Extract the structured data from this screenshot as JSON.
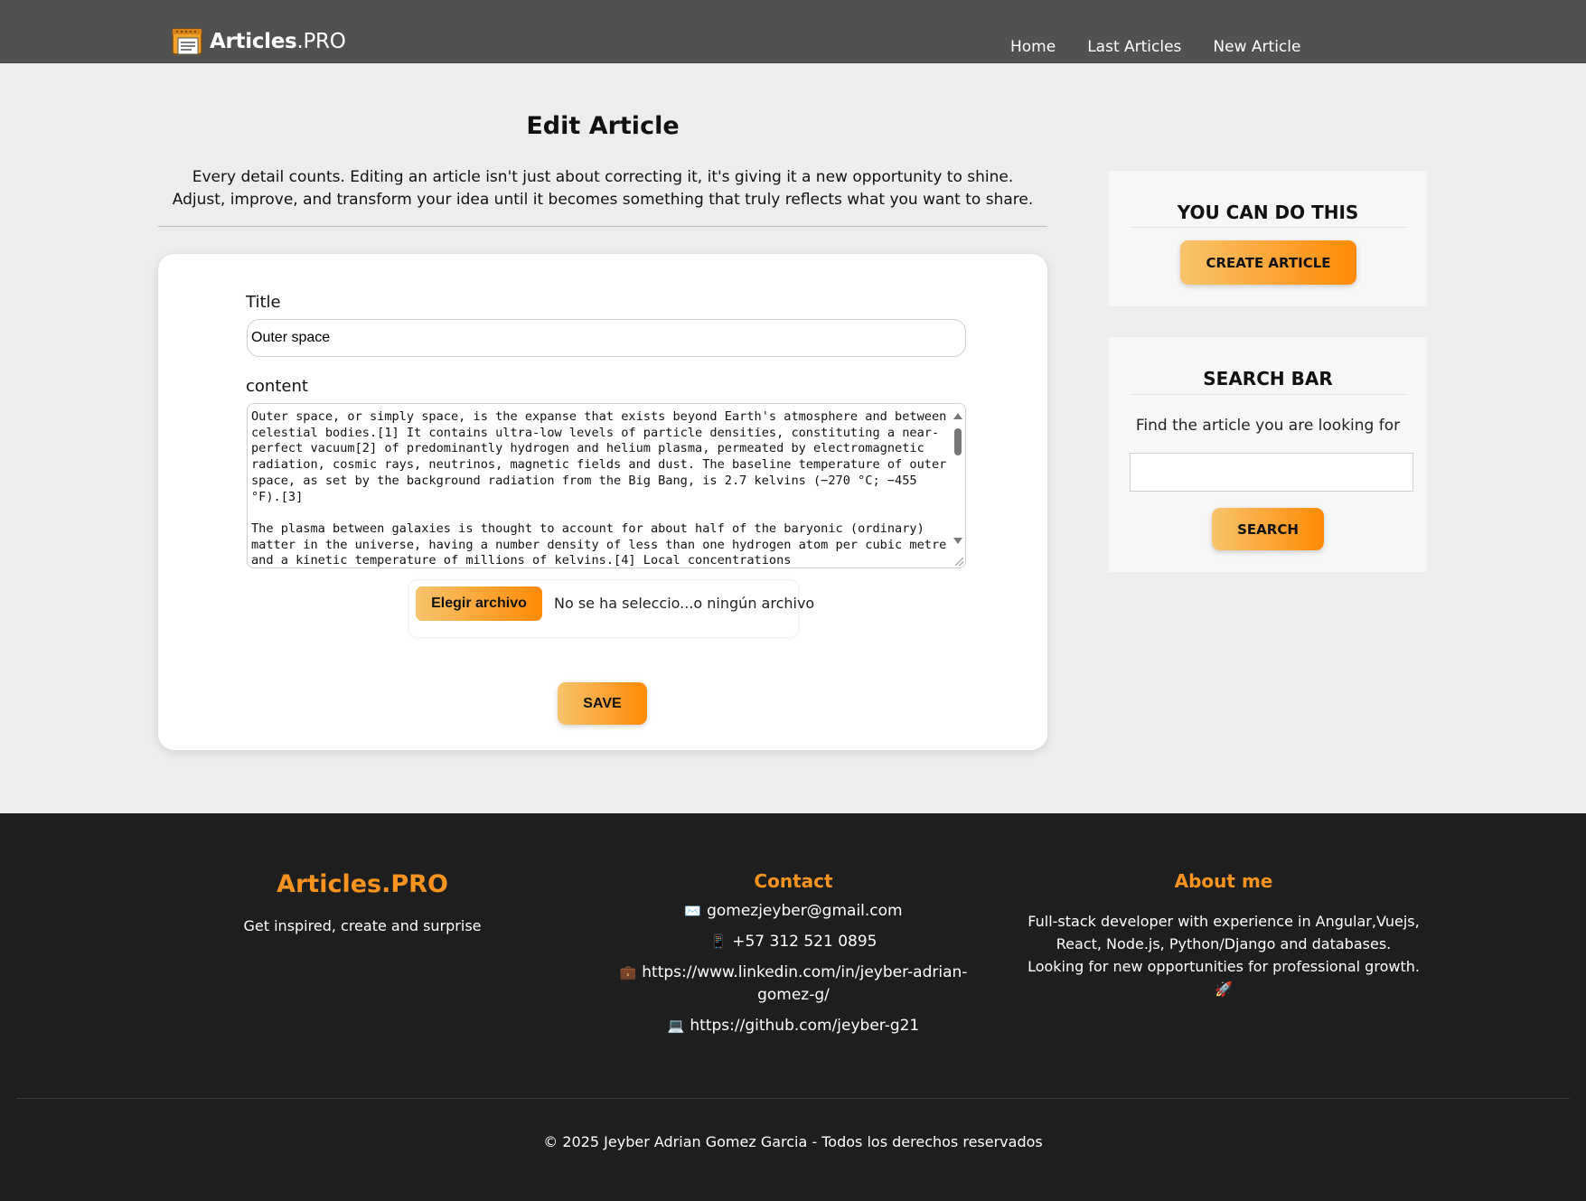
{
  "header": {
    "brand_bold": "Articles",
    "brand_light": ".PRO",
    "nav": [
      "Home",
      "Last Articles",
      "New Article"
    ]
  },
  "main": {
    "title": "Edit Article",
    "intro": "Every detail counts. Editing an article isn't just about correcting it, it's giving it a new opportunity to shine. Adjust, improve, and transform your idea until it becomes something that truly reflects what you want to share.",
    "form": {
      "title_label": "Title",
      "title_value": "Outer space",
      "content_label": "content",
      "content_value": "Outer space, or simply space, is the expanse that exists beyond Earth's atmosphere and between celestial bodies.[1] It contains ultra-low levels of particle densities, constituting a near-perfect vacuum[2] of predominantly hydrogen and helium plasma, permeated by electromagnetic radiation, cosmic rays, neutrinos, magnetic fields and dust. The baseline temperature of outer space, as set by the background radiation from the Big Bang, is 2.7 kelvins (−270 °C; −455 °F).[3]\n\nThe plasma between galaxies is thought to account for about half of the baryonic (ordinary) matter in the universe, having a number density of less than one hydrogen atom per cubic metre and a kinetic temperature of millions of kelvins.[4] Local concentrations",
      "file_button": "Elegir archivo",
      "file_status": "No se ha seleccio...o ningún archivo",
      "save_button": "SAVE"
    }
  },
  "sidebar": {
    "panel_one": {
      "heading": "YOU CAN DO THIS",
      "button": "CREATE ARTICLE"
    },
    "panel_two": {
      "heading": "SEARCH BAR",
      "prompt": "Find the article you are looking for",
      "search_value": "",
      "button": "SEARCH"
    }
  },
  "footer": {
    "brand": "Articles.PRO",
    "tagline": "Get inspired, create and surprise",
    "contact_heading": "Contact",
    "contact": [
      {
        "icon": "✉️",
        "icon_name": "envelope-icon",
        "text": "gomezjeyber@gmail.com"
      },
      {
        "icon": "📱",
        "icon_name": "phone-icon",
        "text": "+57 312 521 0895"
      },
      {
        "icon": "💼",
        "icon_name": "briefcase-icon",
        "text": "https://www.linkedin.com/in/jeyber-adrian-gomez-g/"
      },
      {
        "icon": "💻",
        "icon_name": "laptop-icon",
        "text": "https://github.com/jeyber-g21"
      }
    ],
    "about_heading": "About me",
    "about_text": "Full-stack developer with experience in Angular,Vuejs, React, Node.js, Python/Django and databases. Looking for new opportunities for professional growth. 🚀",
    "copyright": "© 2025 Jeyber Adrian Gomez Garcia - Todos los derechos reservados"
  },
  "colors": {
    "header_bg": "#515151",
    "page_bg": "#eeedeb",
    "footer_bg": "#1e1e1e",
    "accent_orange": "#f7931e",
    "button_gradient_start": "#f7c46c",
    "button_gradient_end": "#ff8a07"
  },
  "icons": {
    "brand": "newspaper-icon"
  }
}
